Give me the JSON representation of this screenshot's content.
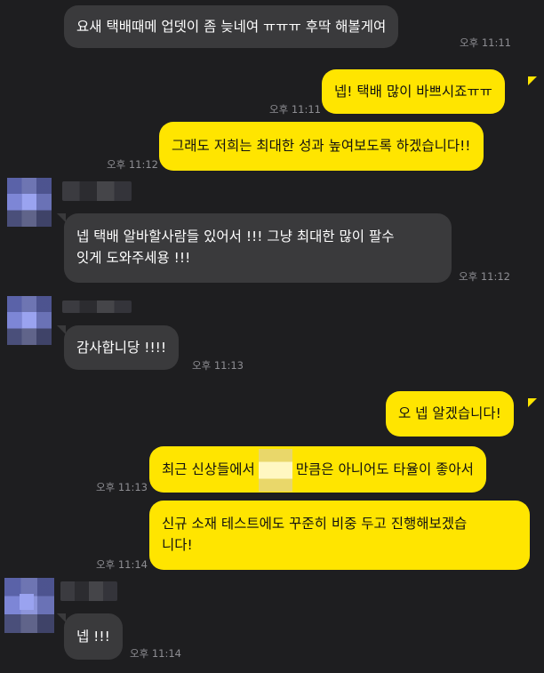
{
  "messages": [
    {
      "text": "요새 택배때메 업뎃이 좀 늦네여 ㅠㅠㅠ 후딱 해볼게여",
      "time": "오후 11:11"
    },
    {
      "text": "넵! 택배 많이 바쁘시죠ㅠㅠ",
      "time": "오후 11:11"
    },
    {
      "text": "그래도 저희는 최대한 성과 높여보도록 하겠습니다!!",
      "time": "오후 11:12"
    },
    {
      "line1": "넵 택배 알바할사람들 있어서 !!! 그냥 최대한 많이 팔수",
      "line2": "잇게 도와주세용 !!!",
      "time": "오후 11:12"
    },
    {
      "text": "감사합니당 !!!!",
      "time": "오후 11:13"
    },
    {
      "text": "오 넵 알겠습니다!",
      "time": ""
    },
    {
      "before": "최근 신상들에서",
      "after": "만큼은 아니어도 타율이 좋아서",
      "time": "오후 11:13"
    },
    {
      "line1": "신규 소재 테스트에도 꾸준히 비중 두고 진행해보겠습",
      "line2": "니다!",
      "time": "오후 11:14"
    },
    {
      "text": "넵 !!!",
      "time": "오후 11:14"
    }
  ],
  "colors": {
    "background": "#1e1e20",
    "incoming": "#3a3a3c",
    "outgoing": "#ffe500"
  }
}
